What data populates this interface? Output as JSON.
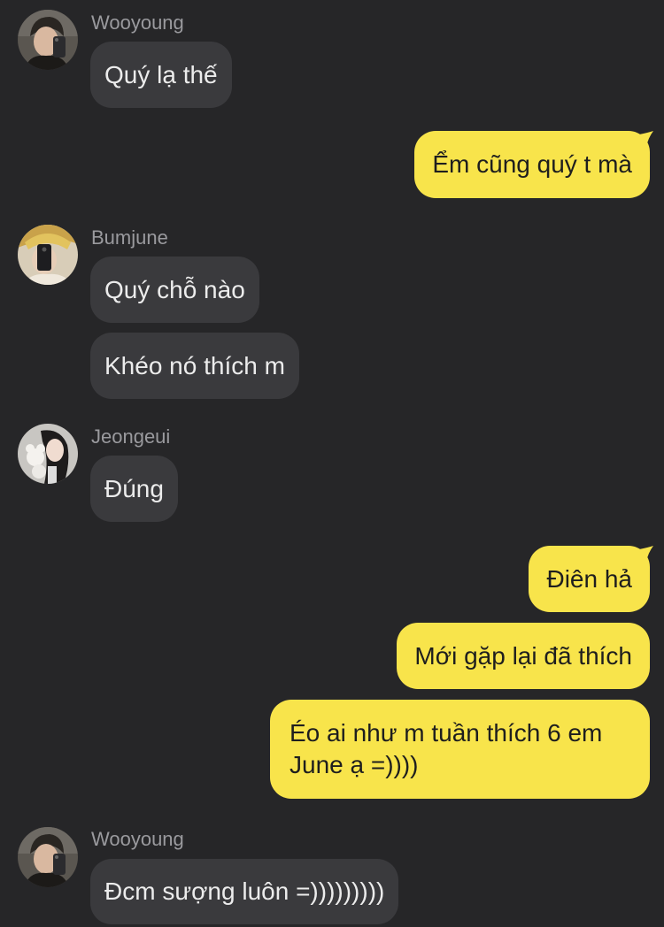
{
  "messages": [
    {
      "type": "incoming",
      "sender": "Wooyoung",
      "text": "Quý lạ thế"
    },
    {
      "type": "outgoing",
      "text": "Ểm cũng quý t mà"
    },
    {
      "type": "incoming",
      "sender": "Bumjune",
      "text": "Quý chỗ nào"
    },
    {
      "type": "incoming",
      "text": "Khéo nó thích m"
    },
    {
      "type": "incoming",
      "sender": "Jeongeui",
      "text": "Đúng"
    },
    {
      "type": "outgoing",
      "text": "Điên hả"
    },
    {
      "type": "outgoing",
      "text": "Mới gặp lại đã thích"
    },
    {
      "type": "outgoing",
      "text": "Éo ai như m tuần thích 6 em June ạ =))))"
    },
    {
      "type": "incoming",
      "sender": "Wooyoung",
      "text": "Đcm sượng luôn =)))))))))"
    }
  ],
  "colors": {
    "background": "#262628",
    "incoming_bubble": "#3a3a3d",
    "outgoing_bubble": "#f8e44b",
    "sender_name": "#9a9a9e"
  },
  "icons": [
    "avatar-wooyoung",
    "avatar-bumjune",
    "avatar-jeongeui"
  ]
}
